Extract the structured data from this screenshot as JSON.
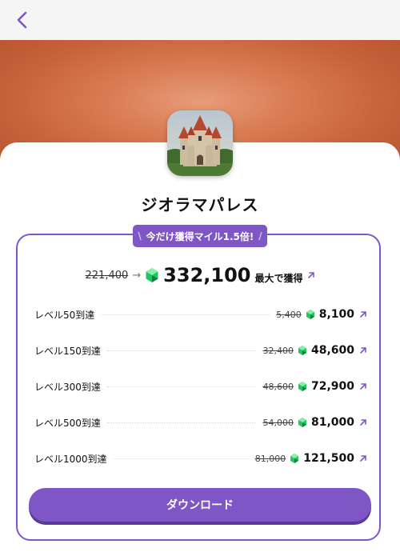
{
  "header": {
    "back_icon": "chevron-left-icon"
  },
  "app": {
    "name": "ジオラマパレス",
    "icon": "castle-icon"
  },
  "promo": {
    "left": "\\",
    "text": "今だけ獲得マイル1.5倍!",
    "right": "/"
  },
  "total": {
    "old": "221,400",
    "arrow": "→",
    "value": "332,100",
    "label": "最大で獲得"
  },
  "rows": [
    {
      "name": "レベル50到達",
      "old": "5,400",
      "value": "8,100"
    },
    {
      "name": "レベル150到達",
      "old": "32,400",
      "value": "48,600"
    },
    {
      "name": "レベル300到達",
      "old": "48,600",
      "value": "72,900"
    },
    {
      "name": "レベル500到達",
      "old": "54,000",
      "value": "81,000"
    },
    {
      "name": "レベル1000到達",
      "old": "81,000",
      "value": "121,500"
    }
  ],
  "download": {
    "label": "ダウンロード"
  },
  "colors": {
    "accent": "#7f56c6",
    "gem": "#22c55e",
    "hero": "#c4603a"
  }
}
